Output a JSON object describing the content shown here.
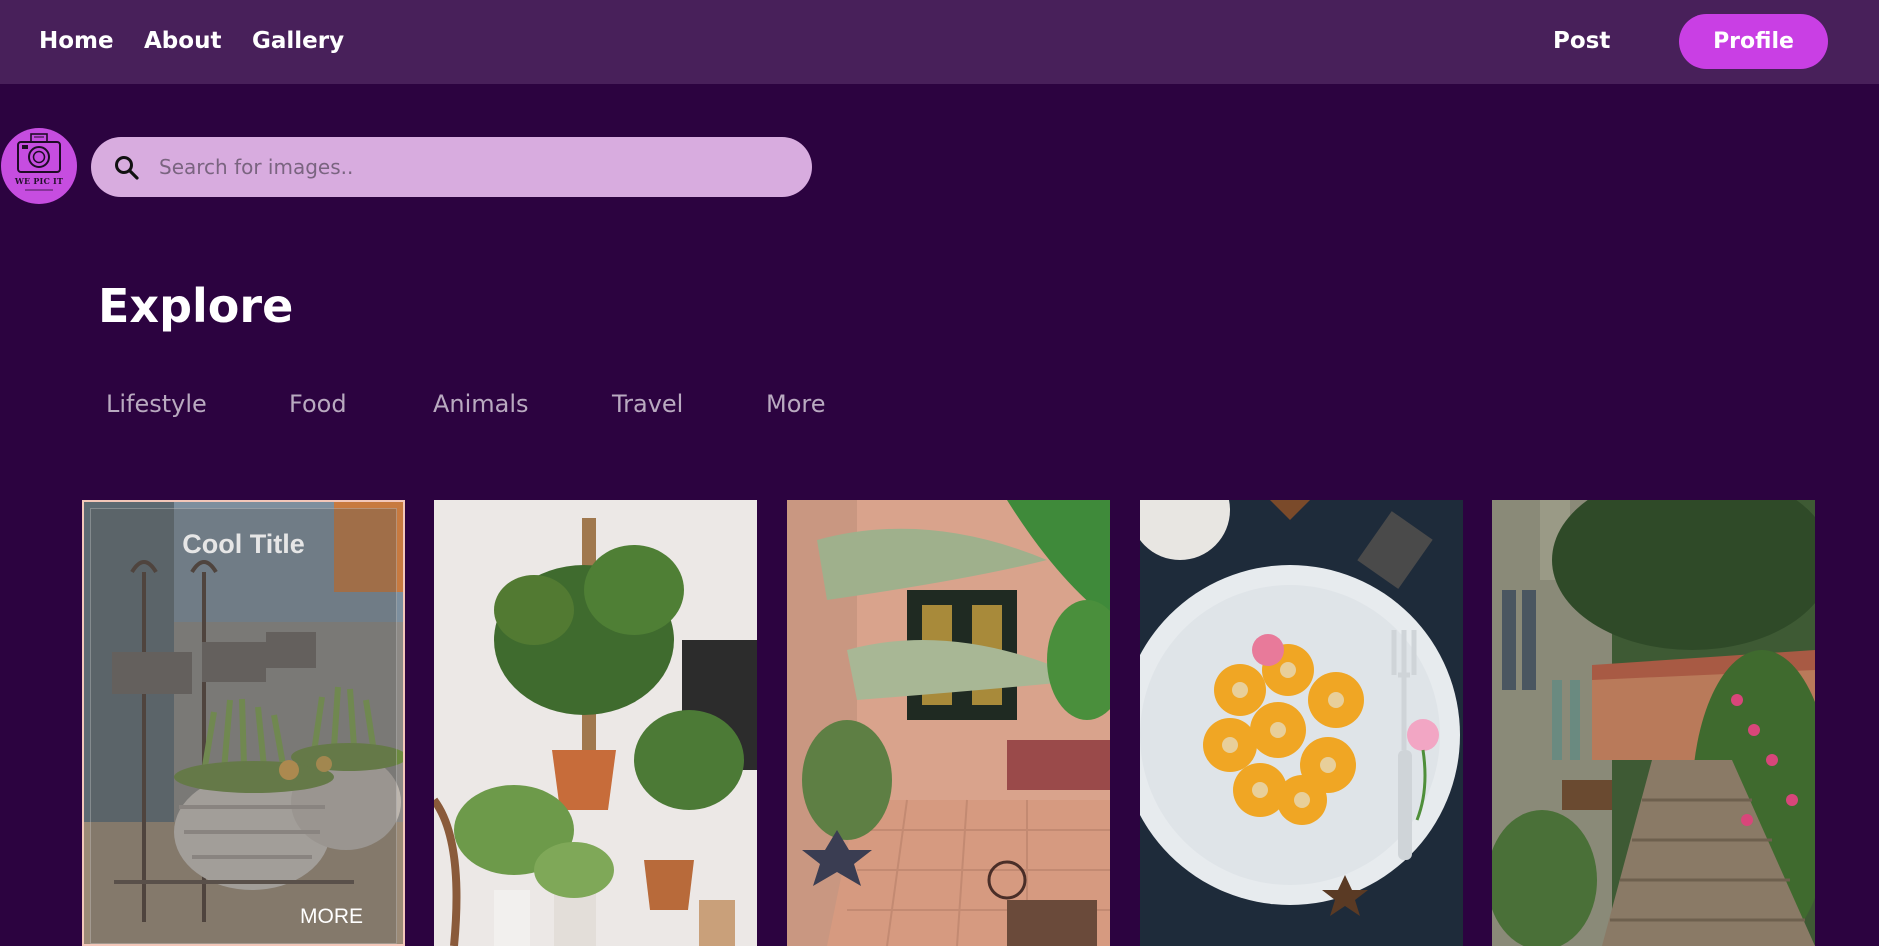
{
  "nav": {
    "home": "Home",
    "about": "About",
    "gallery": "Gallery",
    "post": "Post",
    "profile": "Profile"
  },
  "logo": {
    "text": "WE PIC IT"
  },
  "search": {
    "placeholder": "Search for images..",
    "value": ""
  },
  "explore": {
    "title": "Explore",
    "categories": [
      "Lifestyle",
      "Food",
      "Animals",
      "Travel",
      "More"
    ]
  },
  "cards": [
    {
      "title": "Cool Title",
      "more": "MORE",
      "subject": "welcome-plant-baskets"
    },
    {
      "subject": "potted-house-plants"
    },
    {
      "subject": "courtyard-cafe-plants"
    },
    {
      "subject": "peaches-plate-fork"
    },
    {
      "subject": "garden-cobblestone-path"
    }
  ],
  "colors": {
    "background": "#2c0340",
    "navbar": "#48205a",
    "accent": "#c93fe4",
    "search_bg": "#d8acdf",
    "category_text": "#b9aac0"
  }
}
